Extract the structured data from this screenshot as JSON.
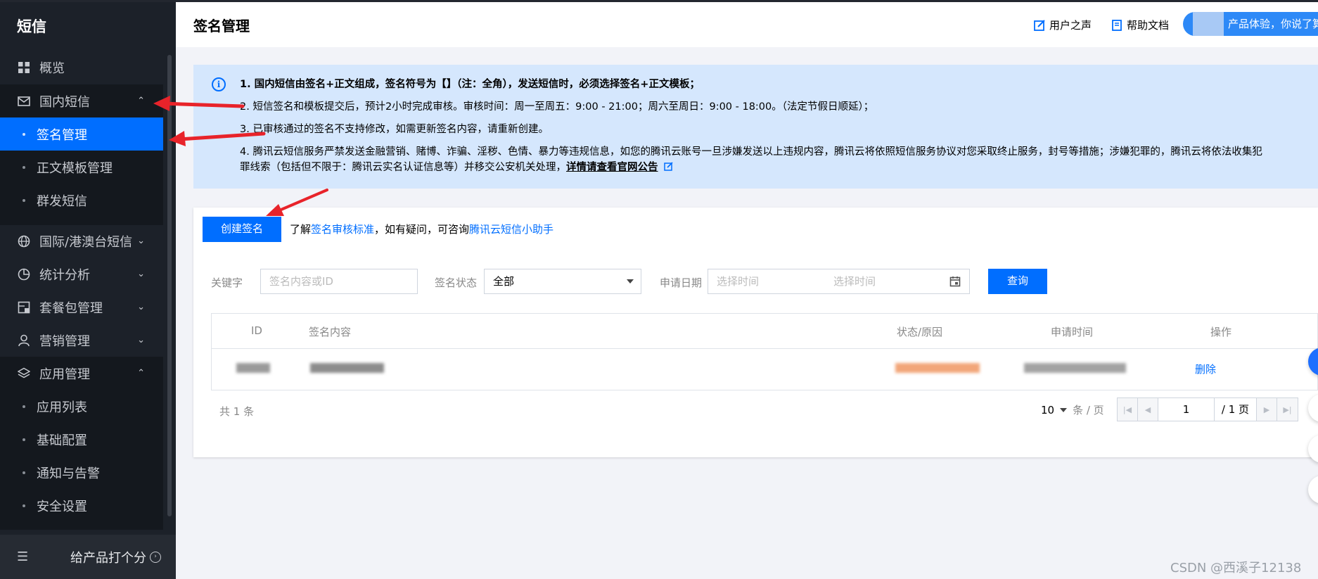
{
  "sidebar": {
    "title": "短信",
    "items": [
      {
        "label": "概览",
        "icon": "grid-icon"
      },
      {
        "label": "国内短信",
        "icon": "mail-icon",
        "expanded": true
      },
      {
        "label": "国际/港澳台短信",
        "icon": "globe-icon",
        "expanded": false
      },
      {
        "label": "统计分析",
        "icon": "pie-chart-icon",
        "expanded": false
      },
      {
        "label": "套餐包管理",
        "icon": "package-icon",
        "expanded": false
      },
      {
        "label": "营销管理",
        "icon": "user-icon",
        "expanded": false
      },
      {
        "label": "应用管理",
        "icon": "layers-icon",
        "expanded": true
      }
    ],
    "domestic_sub": [
      "签名管理",
      "正文模板管理",
      "群发短信"
    ],
    "app_sub": [
      "应用列表",
      "基础配置",
      "通知与告警",
      "安全设置"
    ],
    "active_sub": "签名管理",
    "rate_label": "给产品打个分"
  },
  "header": {
    "title": "签名管理",
    "user_voice": "用户之声",
    "help_doc": "帮助文档",
    "experience": "产品体验，你说了算"
  },
  "notice": {
    "line1": "1. 国内短信由签名+正文组成，签名符号为【】（注：全角），发送短信时，必须选择签名+正文模板；",
    "line2": "2. 短信签名和模板提交后，预计2小时完成审核。审核时间：周一至周五：9:00 - 21:00；周六至周日：9:00 - 18:00。（法定节假日顺延）；",
    "line3": "3. 已审核通过的签名不支持修改，如需更新签名内容，请重新创建。",
    "line4a": "4. 腾讯云短信服务严禁发送金融营销、赌博、诈骗、淫秽、色情、暴力等违规信息，如您的腾讯云账号一旦涉嫌发送以上违规内容，腾讯云将依照短信服务协议对您采取终止服务，封号等措施；涉嫌犯罪的，腾讯云将依法收集犯",
    "line4b": "罪线索（包括但不限于：腾讯云实名认证信息等）并移交公安机关处理，",
    "line4_link": "详情请查看官网公告"
  },
  "toolbar": {
    "create_label": "创建签名",
    "tip_prefix": "了解",
    "tip_link1": "签名审核标准",
    "tip_middle": "，如有疑问，可咨询",
    "tip_link2": "腾讯云短信小助手"
  },
  "filters": {
    "keyword_label": "关键字",
    "keyword_placeholder": "签名内容或ID",
    "status_label": "签名状态",
    "status_value": "全部",
    "date_label": "申请日期",
    "date_start_placeholder": "选择时间",
    "date_end_placeholder": "选择时间",
    "query_label": "查询"
  },
  "table": {
    "columns": [
      "ID",
      "签名内容",
      "状态/原因",
      "申请时间",
      "操作"
    ],
    "rows": [
      {
        "action": "删除"
      }
    ]
  },
  "pagination": {
    "total": "共 1 条",
    "page_size": "10",
    "page_size_unit": "条 / 页",
    "current_page": "1",
    "total_pages": "/ 1 页"
  },
  "watermark": "CSDN @西溪子12138",
  "colors": {
    "primary": "#006eff",
    "sidebar_bg": "#1c2129",
    "notice_bg": "#d5e7fd",
    "annotation_arrow": "#e8232a"
  }
}
